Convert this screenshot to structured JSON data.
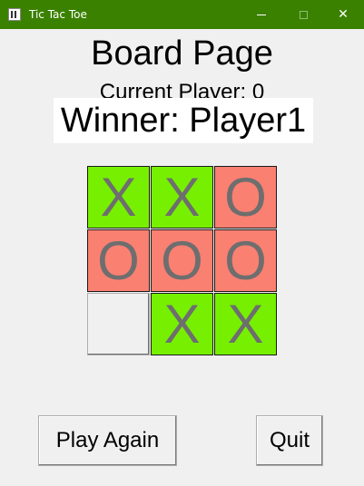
{
  "window": {
    "title": "Tic Tac Toe",
    "accent": "#3a8100",
    "controls": {
      "minimize": "minimize-icon",
      "maximize": "maximize-icon",
      "close_glyph": "✕"
    }
  },
  "page": {
    "title": "Board Page",
    "current_player": "Current Player: 0",
    "winner": "Winner: Player1"
  },
  "board": {
    "colors": {
      "x": "#76f000",
      "o": "#fa8072",
      "empty": "#f0f0f0",
      "mark": "#6e6e6e"
    },
    "cells": [
      "X",
      "X",
      "O",
      "O",
      "O",
      "O",
      "",
      "X",
      "X"
    ]
  },
  "buttons": {
    "play_again": "Play Again",
    "quit": "Quit"
  }
}
